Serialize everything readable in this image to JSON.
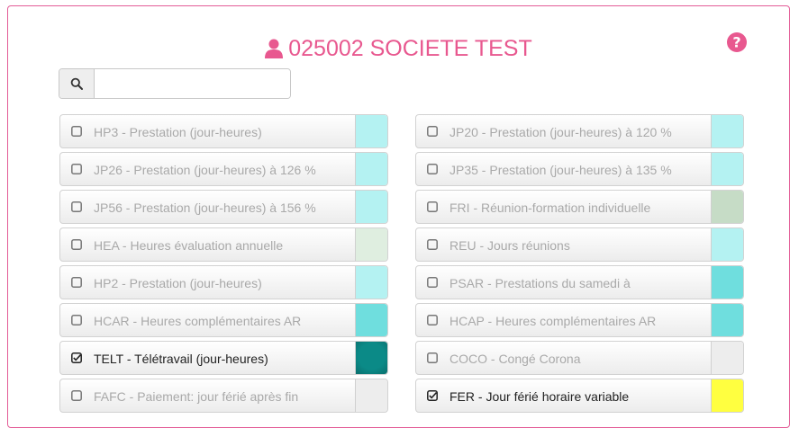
{
  "header": {
    "title": "025002 SOCIETE TEST"
  },
  "search": {
    "value": "",
    "placeholder": ""
  },
  "left_items": [
    {
      "label": "HP3 - Prestation (jour-heures)",
      "checked": false,
      "color": "#b4f2f2"
    },
    {
      "label": "JP26 - Prestation (jour-heures) à 126 %",
      "checked": false,
      "color": "#b4f2f2"
    },
    {
      "label": "JP56 - Prestation (jour-heures) à 156 %",
      "checked": false,
      "color": "#b4f2f2"
    },
    {
      "label": "HEA - Heures évaluation annuelle",
      "checked": false,
      "color": "#dfeee0"
    },
    {
      "label": "HP2 - Prestation (jour-heures)",
      "checked": false,
      "color": "#b4f2f2"
    },
    {
      "label": "HCAR - Heures complémentaires AR",
      "checked": false,
      "color": "#6fdede"
    },
    {
      "label": "TELT - Télétravail (jour-heures)",
      "checked": true,
      "color": "#0b8a87"
    },
    {
      "label": "FAFC - Paiement: jour férié après fin",
      "checked": false,
      "color": "#ededed"
    }
  ],
  "right_items": [
    {
      "label": "JP20 - Prestation (jour-heures) à 120 %",
      "checked": false,
      "color": "#b4f2f2"
    },
    {
      "label": "JP35 - Prestation (jour-heures) à 135 %",
      "checked": false,
      "color": "#b4f2f2"
    },
    {
      "label": "FRI - Réunion-formation individuelle",
      "checked": false,
      "color": "#c6dcc6"
    },
    {
      "label": "REU - Jours réunions",
      "checked": false,
      "color": "#b4f2f2"
    },
    {
      "label": "PSAR - Prestations du samedi à",
      "checked": false,
      "color": "#6fdede"
    },
    {
      "label": "HCAP - Heures complémentaires AR",
      "checked": false,
      "color": "#6fdede"
    },
    {
      "label": "COCO - Congé Corona",
      "checked": false,
      "color": "#ededed"
    },
    {
      "label": "FER - Jour férié horaire variable",
      "checked": true,
      "color": "#ffff40"
    }
  ],
  "colors": {
    "accent": "#e8588f",
    "border": "#e35d97"
  }
}
